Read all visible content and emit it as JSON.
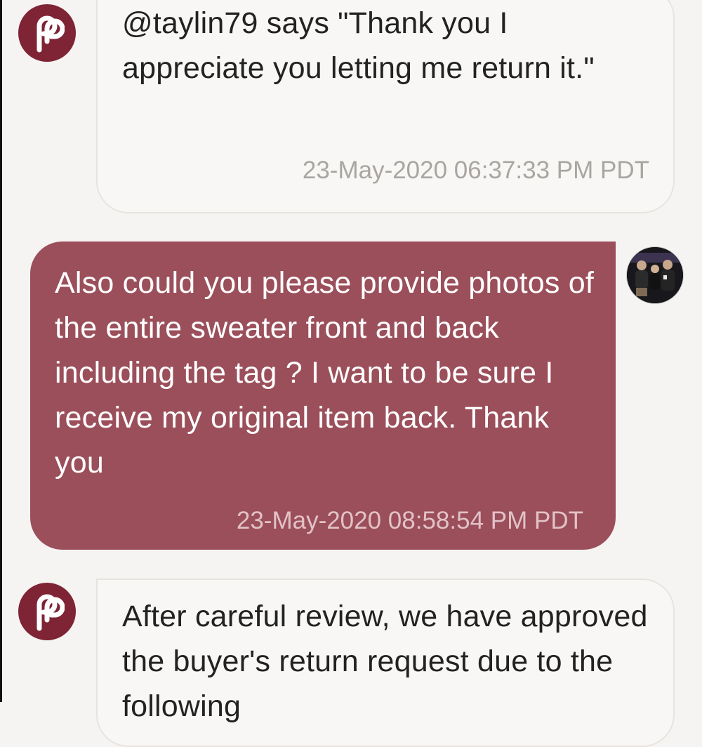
{
  "messages": [
    {
      "sender": "poshmark",
      "text": "@taylin79 says \"Thank you I appreciate you letting me return it.\"",
      "time": "23-May-2020 06:37:33 PM PDT"
    },
    {
      "sender": "me",
      "text": "Also could you please provide photos of the entire sweater front and back including the tag ? I want to be sure I receive my original item back. Thank you",
      "time": "23-May-2020 08:58:54 PM PDT"
    },
    {
      "sender": "poshmark",
      "text": "After careful review, we have approved the buyer's return request due to the following",
      "time": ""
    }
  ],
  "colors": {
    "background": "#f6f4f2",
    "brand": "#7e2434",
    "outgoing_bubble": "#9b4f5a",
    "incoming_bubble": "#f8f7f5"
  },
  "icons": {
    "poshmark": "poshmark-logo-icon",
    "user": "user-avatar"
  }
}
